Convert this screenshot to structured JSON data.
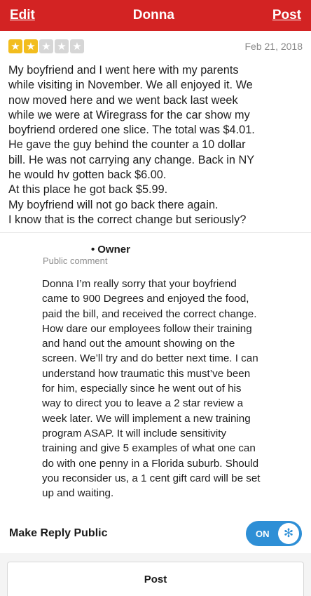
{
  "header": {
    "edit_label": "Edit",
    "title": "Donna",
    "post_label": "Post"
  },
  "review": {
    "rating": 2,
    "max_rating": 5,
    "date": "Feb 21, 2018",
    "text": "My boyfriend and I went here with my parents\nwhile visiting in November. We all enjoyed it. We\nnow moved here and we went back last week\nwhile we were at Wiregrass for the car show my\nboyfriend ordered one slice. The total was $4.01.\nHe gave the guy behind the counter a 10 dollar\nbill. He was not carrying any change. Back in NY\nhe would hv gotten back $6.00.\nAt this place he got back $5.99.\nMy boyfriend will not go back there again.\nI know that is the correct change but seriously?"
  },
  "owner_reply": {
    "owner_label": "Owner",
    "visibility_label": "Public comment",
    "text": "Donna I’m really sorry that your boyfriend\ncame to 900 Degrees and enjoyed the food,\npaid the bill, and received the correct change.\nHow dare our employees follow their training\nand hand out the amount showing on the\nscreen. We’ll try and do better next time.  I can\nunderstand how traumatic this must’ve been\nfor him, especially since he went out of his\nway to direct you to leave a 2 star review a\nweek later. We will implement a new training\nprogram ASAP. It will include sensitivity\ntraining and give 5 examples of what one can\ndo with one penny in a Florida suburb. Should\nyou reconsider us, a 1 cent gift card will be set\nup and waiting."
  },
  "make_public": {
    "label": "Make Reply Public",
    "toggle_text": "ON",
    "toggle_on": true
  },
  "footer": {
    "post_button": "Post"
  },
  "colors": {
    "header_red": "#d32323",
    "star_filled": "#f2bd1e",
    "star_empty": "#d6d6d6",
    "toggle_blue": "#2e8fd6"
  },
  "icons": {
    "star": "star-icon",
    "toggle_knob": "yelp-burst-icon"
  }
}
